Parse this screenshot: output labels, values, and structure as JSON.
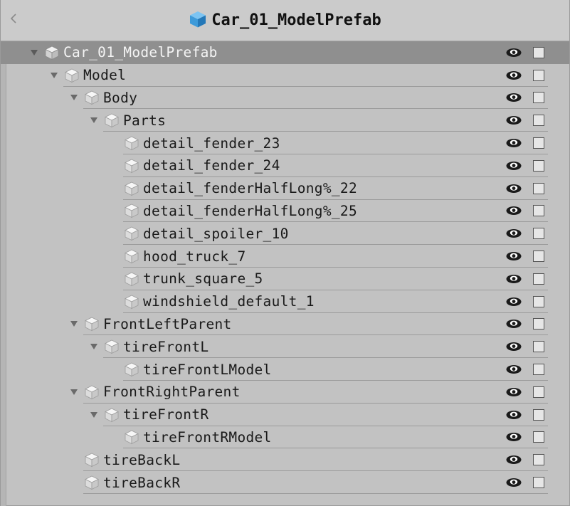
{
  "header": {
    "title": "Car_01_ModelPrefab",
    "back_icon": "chevron-left-icon",
    "prefab_icon": "prefab-cube-icon"
  },
  "colors": {
    "prefab_blue": "#3d9ad9",
    "selected_row": "#8f8f8f",
    "background": "#c2c2c2"
  },
  "tree": [
    {
      "label": "Car_01_ModelPrefab",
      "expanded": true,
      "has_children": true,
      "selected": true
    },
    {
      "label": "Model",
      "expanded": true,
      "has_children": true
    },
    {
      "label": "Body",
      "expanded": true,
      "has_children": true
    },
    {
      "label": "Parts",
      "expanded": true,
      "has_children": true
    },
    {
      "label": "detail_fender_23",
      "has_children": false
    },
    {
      "label": "detail_fender_24",
      "has_children": false
    },
    {
      "label": "detail_fenderHalfLong%_22",
      "has_children": false
    },
    {
      "label": "detail_fenderHalfLong%_25",
      "has_children": false
    },
    {
      "label": "detail_spoiler_10",
      "has_children": false
    },
    {
      "label": "hood_truck_7",
      "has_children": false
    },
    {
      "label": "trunk_square_5",
      "has_children": false
    },
    {
      "label": "windshield_default_1",
      "has_children": false
    },
    {
      "label": "FrontLeftParent",
      "expanded": true,
      "has_children": true
    },
    {
      "label": "tireFrontL",
      "expanded": true,
      "has_children": true
    },
    {
      "label": "tireFrontLModel",
      "has_children": false
    },
    {
      "label": "FrontRightParent",
      "expanded": true,
      "has_children": true
    },
    {
      "label": "tireFrontR",
      "expanded": true,
      "has_children": true
    },
    {
      "label": "tireFrontRModel",
      "has_children": false
    },
    {
      "label": "tireBackL",
      "has_children": false
    },
    {
      "label": "tireBackR",
      "has_children": false
    }
  ],
  "row_controls": {
    "visibility_icon": "eye-icon",
    "checkbox_checked": false
  }
}
